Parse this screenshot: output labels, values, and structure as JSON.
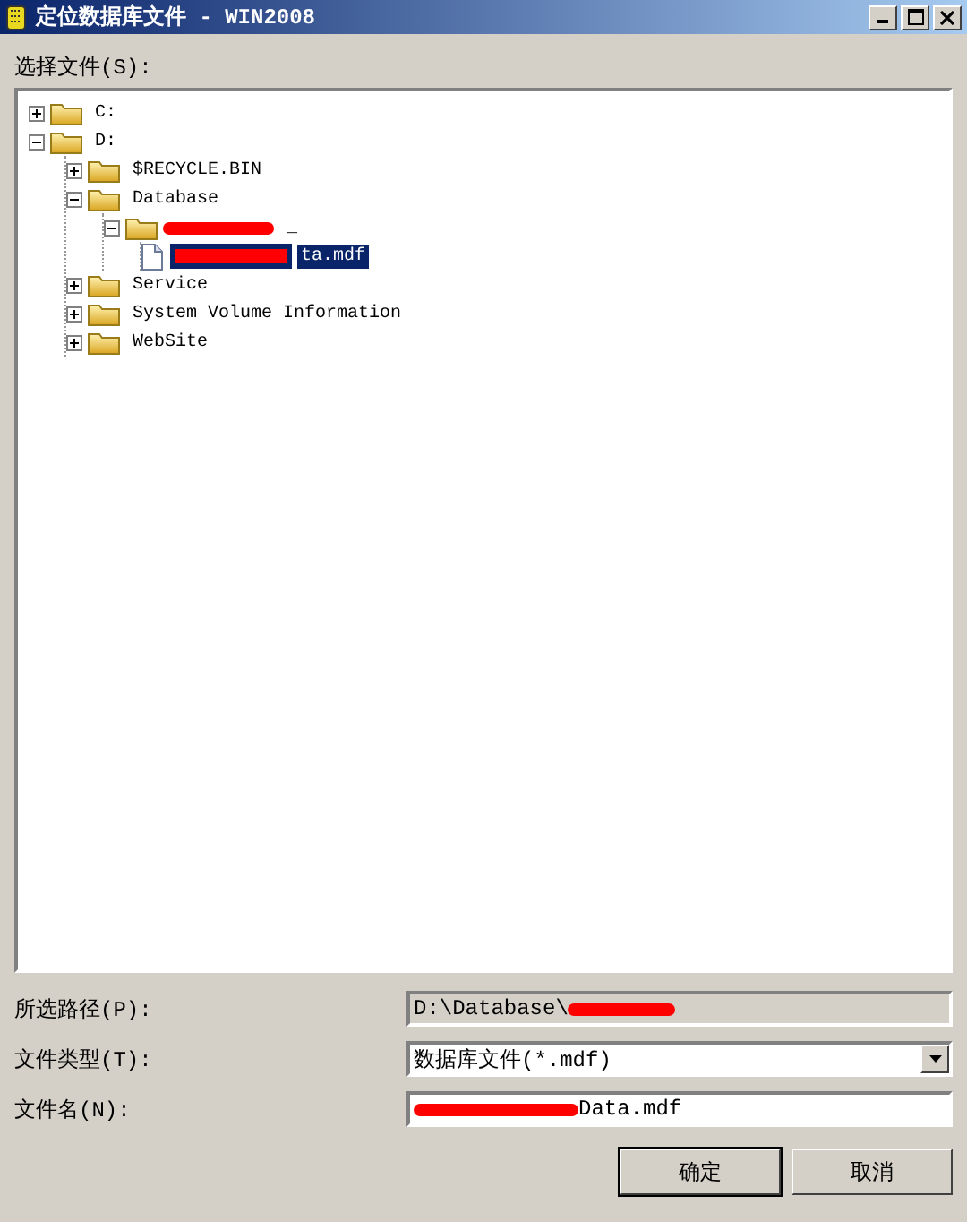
{
  "window": {
    "title": "定位数据库文件 - WIN2008"
  },
  "tree_label": "选择文件(S):",
  "tree": [
    {
      "kind": "folder",
      "label": "C:",
      "expanded": false,
      "selected": false
    },
    {
      "kind": "folder",
      "label": "D:",
      "expanded": true,
      "selected": false,
      "children": [
        {
          "kind": "folder",
          "label": "$RECYCLE.BIN",
          "expanded": false,
          "selected": false
        },
        {
          "kind": "folder",
          "label": "Database",
          "expanded": true,
          "selected": false,
          "children": [
            {
              "kind": "folder",
              "label": "_",
              "redacted": true,
              "expanded": true,
              "selected": false,
              "children": [
                {
                  "kind": "file",
                  "label": "ta.mdf",
                  "redacted": true,
                  "selected": true
                }
              ]
            }
          ]
        },
        {
          "kind": "folder",
          "label": "Service",
          "expanded": false,
          "selected": false
        },
        {
          "kind": "folder",
          "label": "System Volume Information",
          "expanded": false,
          "selected": false
        },
        {
          "kind": "folder",
          "label": "WebSite",
          "expanded": false,
          "selected": false
        }
      ]
    }
  ],
  "fields": [
    {
      "kind": "readonly",
      "label": "所选路径(P):",
      "value": "D:\\Database\\",
      "redacted": true
    },
    {
      "kind": "dropdown",
      "label": "文件类型(T):",
      "value": "数据库文件(*.mdf)"
    },
    {
      "kind": "input",
      "label": "文件名(N):",
      "value": "Data.mdf",
      "redacted": true
    }
  ],
  "buttons": [
    "确定",
    "取消"
  ]
}
